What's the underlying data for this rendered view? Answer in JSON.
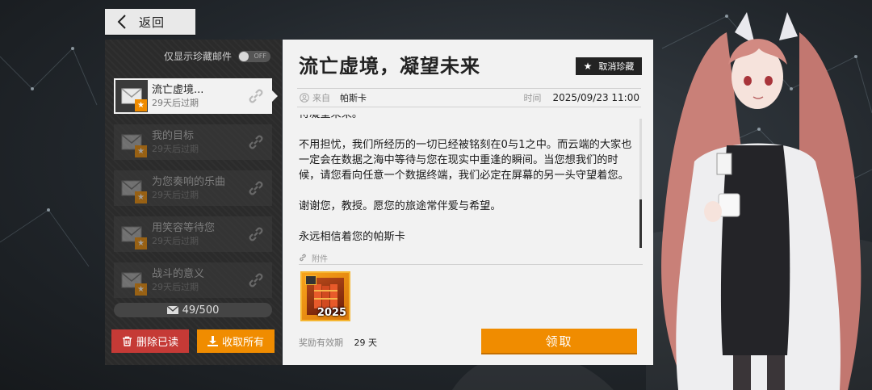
{
  "nav": {
    "back_label": "返回"
  },
  "filter": {
    "label": "仅显示珍藏邮件",
    "toggle_text": "OFF"
  },
  "mail_list": [
    {
      "title": "流亡虚境...",
      "expiry": "29天后过期",
      "active": true
    },
    {
      "title": "我的目标",
      "expiry": "29天后过期",
      "active": false
    },
    {
      "title": "为您奏响的乐曲",
      "expiry": "29天后过期",
      "active": false
    },
    {
      "title": "用笑容等待您",
      "expiry": "29天后过期",
      "active": false
    },
    {
      "title": "战斗的意义",
      "expiry": "29天后过期",
      "active": false
    }
  ],
  "mail_count": "49/500",
  "actions": {
    "delete_read": "删除已读",
    "collect_all": "收取所有"
  },
  "mail": {
    "title": "流亡虚境，凝望未来",
    "favorite_label": "取消珍藏",
    "from_label": "来自",
    "sender": "帕斯卡",
    "time_label": "时间",
    "time": "2025/09/23 11:00",
    "body": [
      "待凝望未来。",
      "不用担忧，我们所经历的一切已经被铭刻在0与1之中。而云端的大家也一定会在数据之海中等待与您在现实中重逢的瞬间。当您想我们的时候，请您看向任意一个数据终端，我们必定在屏幕的另一头守望着您。",
      "谢谢您，教授。愿您的旅途常伴爱与希望。",
      "永远相信着您的帕斯卡"
    ],
    "attachment_label": "附件",
    "attachment": {
      "year_text": "2025",
      "icon": "gift-box-icon"
    },
    "validity_label": "奖励有效期",
    "validity_days": "29 天",
    "claim_label": "领取"
  },
  "colors": {
    "accent_orange": "#f08c00",
    "delete_red": "#c53a36",
    "panel_light": "#f2f2f2",
    "panel_dark": "#2b2b2b"
  }
}
